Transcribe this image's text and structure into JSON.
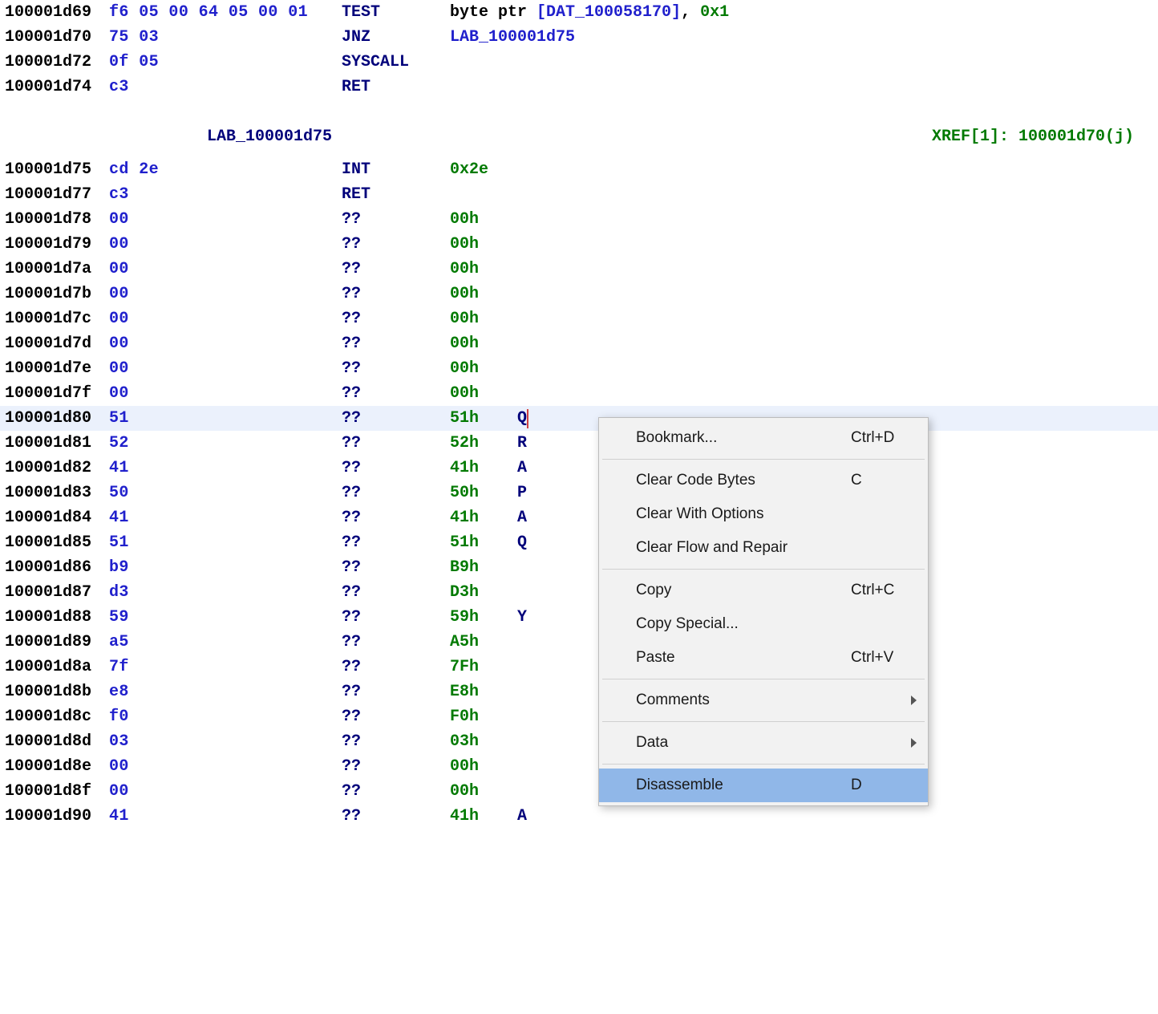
{
  "label": {
    "name": "LAB_100001d75",
    "xref": "XREF[1]:     100001d70(j)"
  },
  "rows": [
    {
      "addr": "100001d69",
      "bytes": "f6 05 00 64 05 00 01",
      "mnem": "TEST",
      "op_pre": "byte ptr ",
      "op_addr": "[DAT_100058170]",
      "op_sep": ", ",
      "op_num": "0x1"
    },
    {
      "addr": "100001d70",
      "bytes": "75 03",
      "mnem": "JNZ",
      "op_addr": "LAB_100001d75"
    },
    {
      "addr": "100001d72",
      "bytes": "0f 05",
      "mnem": "SYSCALL"
    },
    {
      "addr": "100001d74",
      "bytes": "c3",
      "mnem": "RET"
    },
    {
      "kind": "label"
    },
    {
      "addr": "100001d75",
      "bytes": "cd 2e",
      "mnem": "INT",
      "op_num": "0x2e"
    },
    {
      "addr": "100001d77",
      "bytes": "c3",
      "mnem": "RET"
    },
    {
      "addr": "100001d78",
      "bytes": "00",
      "mnem": "??",
      "op_num": "00h"
    },
    {
      "addr": "100001d79",
      "bytes": "00",
      "mnem": "??",
      "op_num": "00h"
    },
    {
      "addr": "100001d7a",
      "bytes": "00",
      "mnem": "??",
      "op_num": "00h"
    },
    {
      "addr": "100001d7b",
      "bytes": "00",
      "mnem": "??",
      "op_num": "00h"
    },
    {
      "addr": "100001d7c",
      "bytes": "00",
      "mnem": "??",
      "op_num": "00h"
    },
    {
      "addr": "100001d7d",
      "bytes": "00",
      "mnem": "??",
      "op_num": "00h"
    },
    {
      "addr": "100001d7e",
      "bytes": "00",
      "mnem": "??",
      "op_num": "00h"
    },
    {
      "addr": "100001d7f",
      "bytes": "00",
      "mnem": "??",
      "op_num": "00h"
    },
    {
      "addr": "100001d80",
      "bytes": "51",
      "mnem": "??",
      "op_num": "51h",
      "char4": "Q",
      "selected": true,
      "cursor": true
    },
    {
      "addr": "100001d81",
      "bytes": "52",
      "mnem": "??",
      "op_num": "52h",
      "char4": "R"
    },
    {
      "addr": "100001d82",
      "bytes": "41",
      "mnem": "??",
      "op_num": "41h",
      "char4": "A"
    },
    {
      "addr": "100001d83",
      "bytes": "50",
      "mnem": "??",
      "op_num": "50h",
      "char4": "P"
    },
    {
      "addr": "100001d84",
      "bytes": "41",
      "mnem": "??",
      "op_num": "41h",
      "char4": "A"
    },
    {
      "addr": "100001d85",
      "bytes": "51",
      "mnem": "??",
      "op_num": "51h",
      "char4": "Q"
    },
    {
      "addr": "100001d86",
      "bytes": "b9",
      "mnem": "??",
      "op_num": "B9h"
    },
    {
      "addr": "100001d87",
      "bytes": "d3",
      "mnem": "??",
      "op_num": "D3h"
    },
    {
      "addr": "100001d88",
      "bytes": "59",
      "mnem": "??",
      "op_num": "59h",
      "char4": "Y"
    },
    {
      "addr": "100001d89",
      "bytes": "a5",
      "mnem": "??",
      "op_num": "A5h"
    },
    {
      "addr": "100001d8a",
      "bytes": "7f",
      "mnem": "??",
      "op_num": "7Fh"
    },
    {
      "addr": "100001d8b",
      "bytes": "e8",
      "mnem": "??",
      "op_num": "E8h"
    },
    {
      "addr": "100001d8c",
      "bytes": "f0",
      "mnem": "??",
      "op_num": "F0h"
    },
    {
      "addr": "100001d8d",
      "bytes": "03",
      "mnem": "??",
      "op_num": "03h"
    },
    {
      "addr": "100001d8e",
      "bytes": "00",
      "mnem": "??",
      "op_num": "00h"
    },
    {
      "addr": "100001d8f",
      "bytes": "00",
      "mnem": "??",
      "op_num": "00h"
    },
    {
      "addr": "100001d90",
      "bytes": "41",
      "mnem": "??",
      "op_num": "41h",
      "char4": "A"
    }
  ],
  "menu": [
    {
      "label": "Bookmark...",
      "shortcut": "Ctrl+D"
    },
    {
      "sep": true
    },
    {
      "label": "Clear Code Bytes",
      "shortcut": "C"
    },
    {
      "label": "Clear With Options"
    },
    {
      "label": "Clear Flow and Repair"
    },
    {
      "sep": true
    },
    {
      "label": "Copy",
      "shortcut": "Ctrl+C"
    },
    {
      "label": "Copy Special..."
    },
    {
      "label": "Paste",
      "shortcut": "Ctrl+V"
    },
    {
      "sep": true
    },
    {
      "label": "Comments",
      "sub": true
    },
    {
      "sep": true
    },
    {
      "label": "Data",
      "sub": true
    },
    {
      "sep": true
    },
    {
      "label": "Disassemble",
      "shortcut": "D",
      "highlight": true
    }
  ]
}
